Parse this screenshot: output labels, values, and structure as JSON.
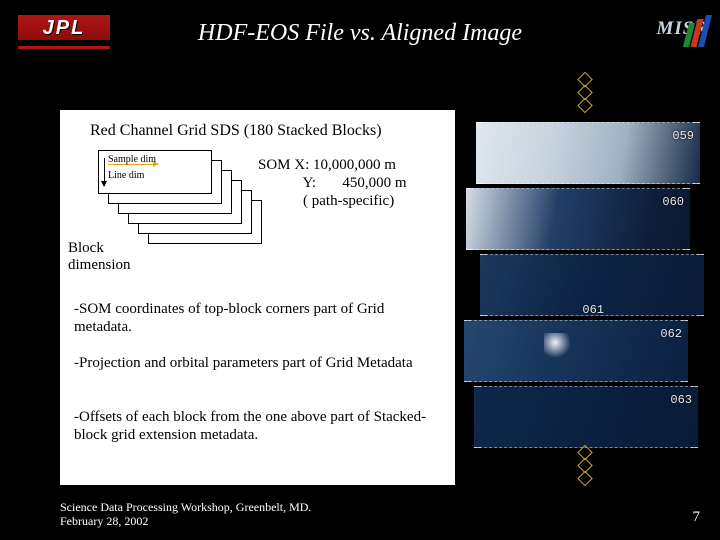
{
  "header": {
    "jpl_label": "JPL",
    "title": "HDF-EOS File vs. Aligned Image",
    "misr_label": "MISR"
  },
  "panel": {
    "red_channel_title": "Red Channel Grid SDS (180 Stacked Blocks)",
    "sample_dim_label": "Sample dim",
    "line_dim_label": "Line dim",
    "som_text": "SOM X: 10,000,000 m\n            Y:       450,000 m\n            ( path-specific)",
    "block_dimension_label": "Block\ndimension",
    "notes": {
      "n1": "-SOM coordinates of top-block corners part of Grid metadata.",
      "n2": "-Projection  and orbital parameters part of Grid Metadata",
      "n3": "-Offsets of each block from the one above part of Stacked-block grid extension metadata."
    }
  },
  "sat": {
    "tiles": {
      "t059": "059",
      "t060": "060",
      "t061": "061",
      "t062": "062",
      "t063": "063"
    }
  },
  "footer": {
    "venue": "Science Data Processing Workshop, Greenbelt, MD.",
    "date": "February 28, 2002",
    "slide_number": "7"
  }
}
